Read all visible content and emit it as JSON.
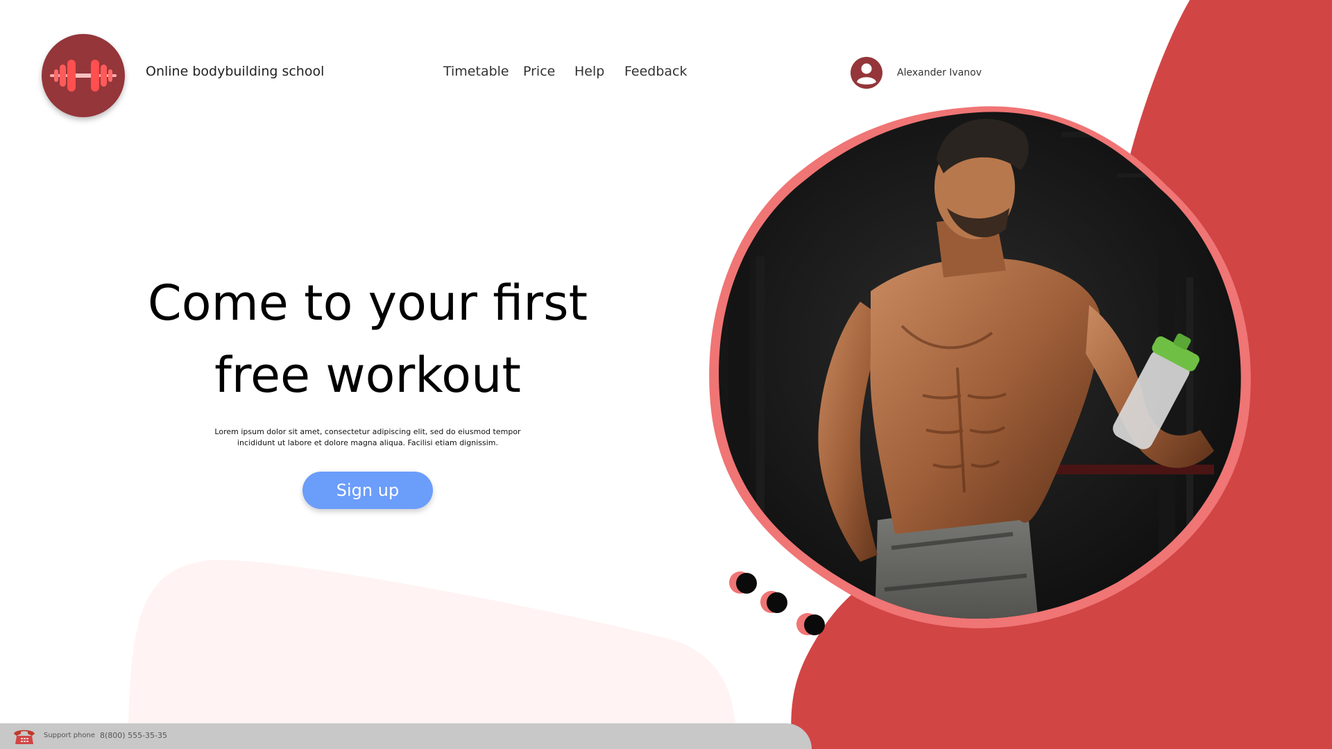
{
  "header": {
    "brand": "Online bodybuilding school",
    "logo_icon": "dumbbell-icon",
    "nav": [
      "Timetable",
      "Price",
      "Help",
      "Feedback"
    ],
    "user_name": "Alexander Ivanov",
    "user_icon": "user-avatar-icon"
  },
  "hero": {
    "headline_line1": "Come to your first",
    "headline_line2": "free workout",
    "subtext_line1": "Lorem ipsum dolor sit amet, consectetur adipiscing elit, sed do eiusmod tempor",
    "subtext_line2": "incididunt ut labore et dolore magna aliqua. Facilisi etiam dignissim.",
    "cta_label": "Sign up",
    "photo_icon": "bodybuilder-photo"
  },
  "footer": {
    "support_label": "Support phone",
    "support_number": "8(800) 555-35-35",
    "phone_icon": "telephone-icon"
  },
  "colors": {
    "accent_red": "#d24545",
    "logo_bg": "#94363a",
    "button_blue": "#6b9dfb",
    "photo_border": "#f07575",
    "footer_bg": "#c8c8c8"
  }
}
